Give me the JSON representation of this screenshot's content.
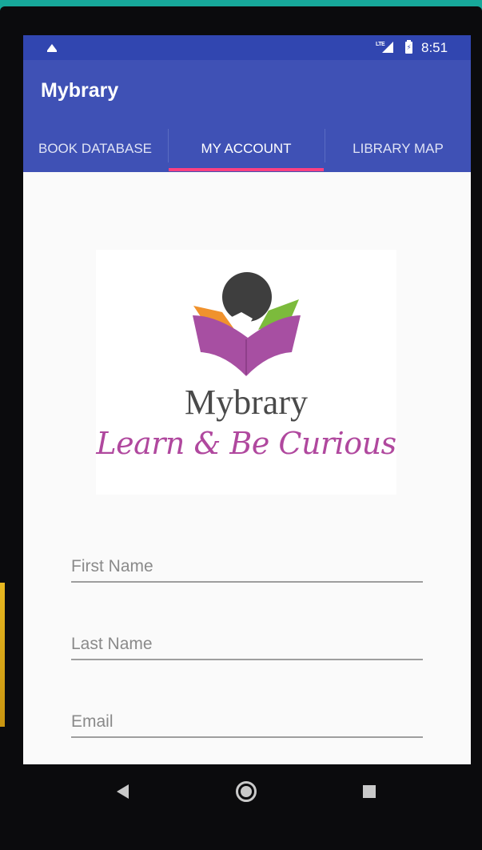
{
  "status_bar": {
    "network_label": "LTE",
    "time": "8:51",
    "icons": [
      "notification-icon",
      "signal-icon",
      "battery-charging-icon"
    ]
  },
  "app_bar": {
    "title": "Mybrary",
    "tabs": [
      {
        "label": "BOOK DATABASE",
        "selected": false
      },
      {
        "label": "MY ACCOUNT",
        "selected": true
      },
      {
        "label": "LIBRARY MAP",
        "selected": false
      }
    ]
  },
  "logo": {
    "name": "Mybrary",
    "tagline": "Learn & Be Curious"
  },
  "form": {
    "first_name": {
      "placeholder": "First Name",
      "value": ""
    },
    "last_name": {
      "placeholder": "Last Name",
      "value": ""
    },
    "email": {
      "placeholder": "Email",
      "value": ""
    }
  },
  "nav_bar": {
    "buttons": [
      "back-icon",
      "home-icon",
      "recents-icon"
    ]
  },
  "colors": {
    "status_bar": "#3146b0",
    "primary": "#3f51b5",
    "accent": "#ff4081",
    "logo_purple": "#a74fa2",
    "logo_orange": "#f0922d",
    "logo_green": "#7cbb3c",
    "background": "#fafafa",
    "outer_background": "#17a89a"
  }
}
